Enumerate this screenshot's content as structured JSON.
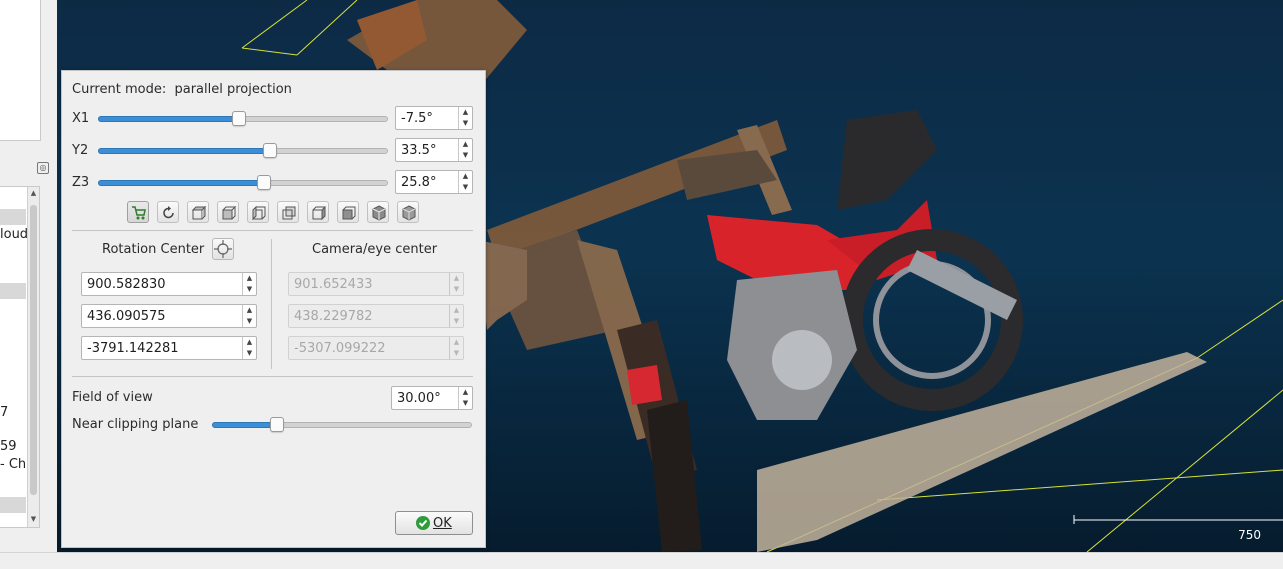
{
  "dialog": {
    "mode_label": "Current mode:",
    "mode_value": "parallel projection",
    "rotation_sliders": [
      {
        "label": "X1",
        "value": "-7.5°",
        "position": 0.48
      },
      {
        "label": "Y2",
        "value": "33.5°",
        "position": 0.59
      },
      {
        "label": "Z3",
        "value": "25.8°",
        "position": 0.57
      }
    ],
    "view_buttons": [
      "pivot-visibility-icon",
      "reset-view-icon",
      "top-view-icon",
      "front-view-icon",
      "left-view-icon",
      "back-view-icon",
      "right-view-icon",
      "bottom-view-icon",
      "iso-front-icon",
      "iso-back-icon"
    ],
    "rotation_center": {
      "title": "Rotation Center",
      "x": "900.582830",
      "y": "436.090575",
      "z": "-3791.142281"
    },
    "camera_center": {
      "title": "Camera/eye center",
      "x": "901.652433",
      "y": "438.229782",
      "z": "-5307.099222"
    },
    "field_of_view": {
      "label": "Field of view",
      "value": "30.00°"
    },
    "near_clipping": {
      "label": "Near clipping plane",
      "position": 0.25
    },
    "ok_button": "OK"
  },
  "left_strip": {
    "lines": [
      "loud",
      "7",
      "59",
      "- Ch"
    ]
  },
  "viewport": {
    "scale_value": "750",
    "background_top": "#0d2a45",
    "background_bottom": "#061c2e",
    "accent": "#3c8fd6"
  }
}
